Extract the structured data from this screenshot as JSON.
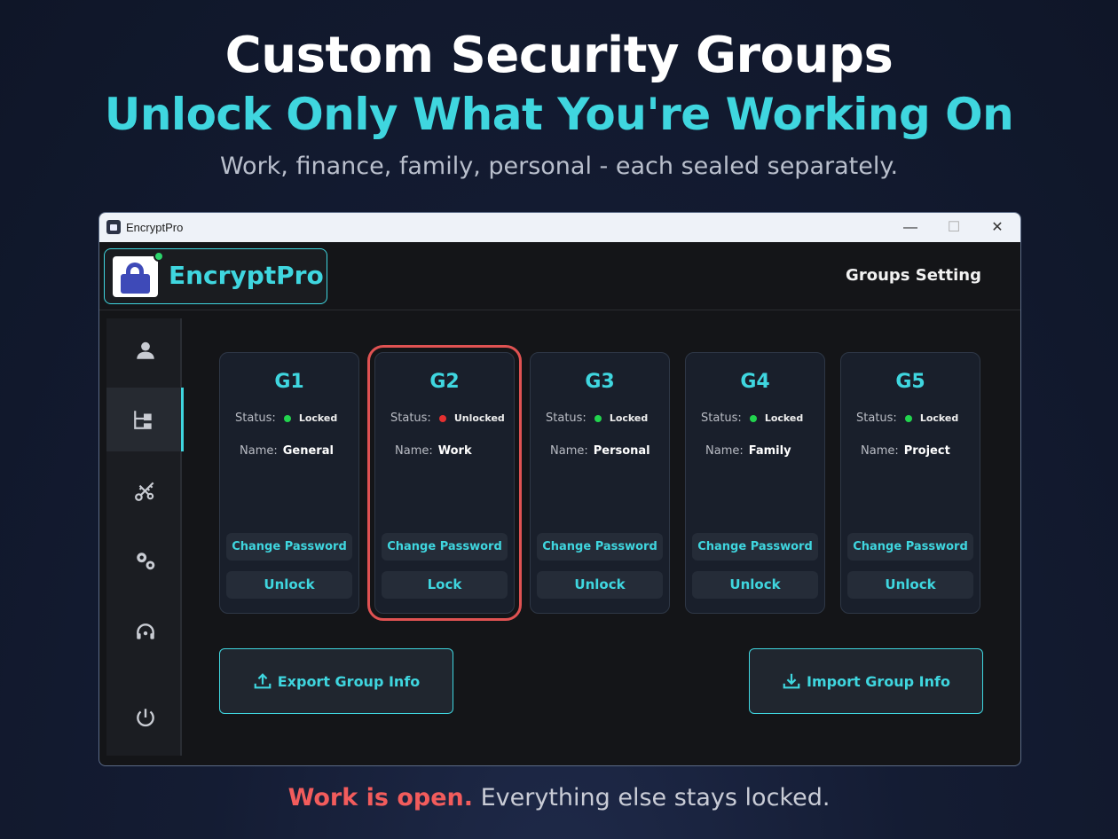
{
  "hero": {
    "title": "Custom Security Groups",
    "subtitle": "Unlock Only What You're Working On",
    "tagline": "Work, finance, family, personal - each sealed separately."
  },
  "footer": {
    "highlight": "Work is open.",
    "rest": " Everything else stays locked."
  },
  "window": {
    "title": "EncryptPro",
    "controls": {
      "minimize": "—",
      "maximize": "☐",
      "close": "✕"
    }
  },
  "header": {
    "logo_text": "EncryptPro",
    "page_title": "Groups Setting"
  },
  "sidebar": {
    "items": [
      {
        "icon": "user-icon"
      },
      {
        "icon": "groups-tree-icon",
        "active": true
      },
      {
        "icon": "keys-icon"
      },
      {
        "icon": "settings-gears-icon"
      },
      {
        "icon": "support-headset-icon"
      },
      {
        "icon": "power-icon"
      }
    ]
  },
  "labels": {
    "status": "Status:",
    "name": "Name:",
    "change_password": "Change Password"
  },
  "groups": [
    {
      "id": "G1",
      "status": "Locked",
      "name": "General",
      "action": "Unlock"
    },
    {
      "id": "G2",
      "status": "Unlocked",
      "name": "Work",
      "action": "Lock"
    },
    {
      "id": "G3",
      "status": "Locked",
      "name": "Personal",
      "action": "Unlock"
    },
    {
      "id": "G4",
      "status": "Locked",
      "name": "Family",
      "action": "Unlock"
    },
    {
      "id": "G5",
      "status": "Locked",
      "name": "Project",
      "action": "Unlock"
    }
  ],
  "actions": {
    "export": "Export Group Info",
    "import": "Import Group Info"
  },
  "colors": {
    "accent": "#3fd6df",
    "locked": "#22d44e",
    "unlocked": "#e53030",
    "highlight": "#e05252"
  }
}
